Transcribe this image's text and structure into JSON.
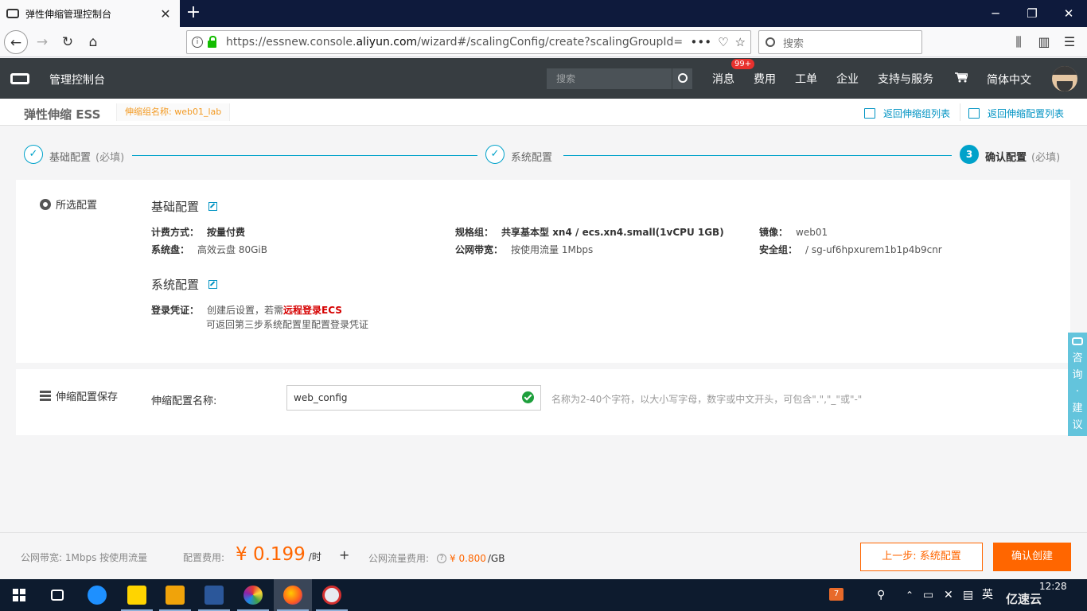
{
  "browser": {
    "tab_title": "弹性伸缩管理控制台",
    "url_prefix": "https://essnew.console.",
    "url_domain": "aliyun.com",
    "url_suffix": "/wizard#/scalingConfig/create?scalingGroupId=",
    "search_placeholder": "搜索"
  },
  "header": {
    "console": "管理控制台",
    "search_placeholder": "搜索",
    "nav": [
      {
        "label": "消息",
        "badge": "99+"
      },
      {
        "label": "费用"
      },
      {
        "label": "工单"
      },
      {
        "label": "企业"
      },
      {
        "label": "支持与服务"
      }
    ],
    "language": "简体中文"
  },
  "subheader": {
    "product": "弹性伸缩 ESS",
    "group": "伸缩组名称: web01_lab",
    "back_group_list": "返回伸缩组列表",
    "back_config_list": "返回伸缩配置列表"
  },
  "steps": [
    {
      "num": "✓",
      "label": "基础配置",
      "note": "(必填)"
    },
    {
      "num": "✓",
      "label": "系统配置",
      "note": ""
    },
    {
      "num": "3",
      "label": "确认配置",
      "note": "(必填)"
    }
  ],
  "summary": {
    "section": "所选配置",
    "basic": {
      "title": "基础配置",
      "billing_k": "计费方式：",
      "billing_v": "按量付费",
      "spec_k": "规格组：",
      "spec_v": "共享基本型 xn4 / ecs.xn4.small(1vCPU 1GB)",
      "image_k": "镜像：",
      "image_v": "web01",
      "disk_k": "系统盘：",
      "disk_v": "高效云盘 80GiB",
      "bw_k": "公网带宽：",
      "bw_v": "按使用流量 1Mbps",
      "sg_k": "安全组：",
      "sg_v": "/ sg-uf6hpxurem1b1p4b9cnr"
    },
    "system": {
      "title": "系统配置",
      "login_k": "登录凭证：",
      "login_v1": "创建后设置，若需",
      "login_link": "远程登录ECS",
      "login_v2": "可返回第三步系统配置里配置登录凭证"
    }
  },
  "save": {
    "section": "伸缩配置保存",
    "label": "伸缩配置名称:",
    "value": "web_config",
    "hint": "名称为2-40个字符，以大小写字母，数字或中文开头，可包含\".\",\"_\"或\"-\""
  },
  "feedback": [
    "咨",
    "询",
    "·",
    "建",
    "议"
  ],
  "footer": {
    "bandwidth": "公网带宽: 1Mbps 按使用流量",
    "config_fee_label": "配置费用:",
    "price": "¥ 0.199",
    "price_unit": "/时",
    "plus": "+",
    "traffic_label": "公网流量费用:",
    "traffic_price": "¥ 0.800",
    "traffic_unit": "/GB",
    "prev_button": "上一步: 系统配置",
    "confirm_button": "确认创建"
  },
  "taskbar": {
    "lang": "英",
    "time": "12:28",
    "watermark": "亿速云"
  },
  "colors": {
    "accent": "#00a2ca",
    "orange": "#ff6600",
    "header_bg": "#373d41"
  }
}
